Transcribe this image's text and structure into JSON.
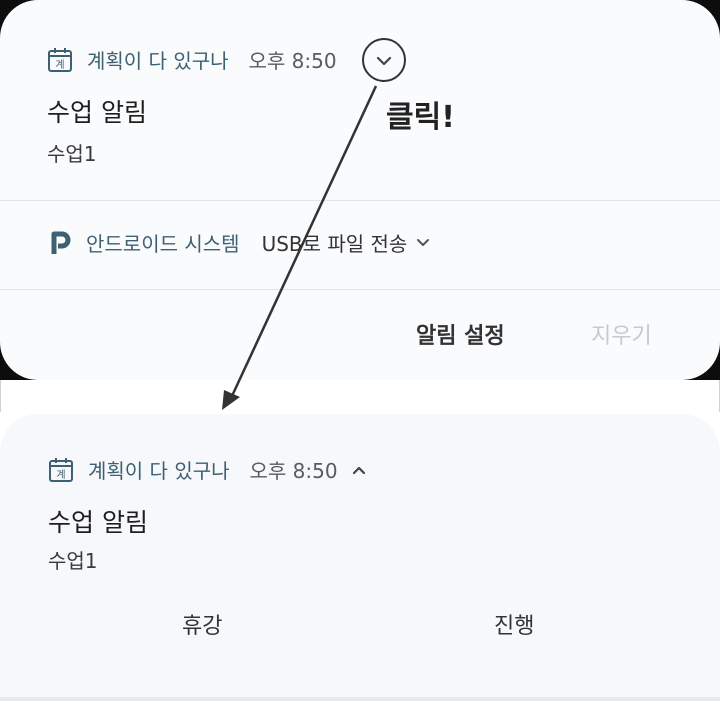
{
  "top_notification": {
    "app_name": "계획이 다 있구나",
    "time": "오후 8:50",
    "title": "수업 알림",
    "body": "수업1"
  },
  "annotation": {
    "click_label": "클릭!"
  },
  "system_notification": {
    "app_name": "안드로이드 시스템",
    "message": "USB로 파일 전송"
  },
  "footer_buttons": {
    "settings": "알림 설정",
    "clear": "지우기"
  },
  "expanded_notification": {
    "app_name": "계획이 다 있구나",
    "time": "오후 8:50",
    "title": "수업 알림",
    "body": "수업1",
    "actions": [
      "휴강",
      "진행"
    ]
  },
  "colors": {
    "app_accent": "#3d6073",
    "card_bg": "#fafbfd",
    "disabled_text": "#c7c9cc"
  }
}
